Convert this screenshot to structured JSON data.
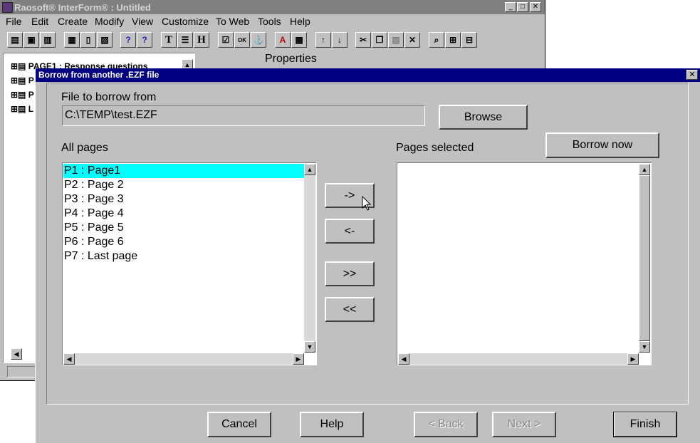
{
  "app": {
    "title": "Raosoft® InterForm® : Untitled",
    "menu": [
      "File",
      "Edit",
      "Create",
      "Modify",
      "View",
      "Customize",
      "To Web",
      "Tools",
      "Help"
    ],
    "tree_items": [
      "PAGE1 : Response questions",
      "P",
      "P",
      "L"
    ],
    "properties_label": "Properties",
    "toolbar_icons": [
      "open-icon",
      "save-icon",
      "print-icon",
      "page-icon",
      "new-page-icon",
      "copy-page-icon",
      "spell-icon",
      "wizard-icon",
      "text-icon",
      "list-icon",
      "heading-icon",
      "checkbox-icon",
      "ok-button-icon",
      "anchor-icon",
      "font-color-icon",
      "form-properties-icon",
      "move-up-icon",
      "move-down-icon",
      "cut-icon",
      "copy-icon",
      "paste-icon",
      "delete-icon",
      "preview-icon",
      "expand-icon",
      "collapse-icon"
    ]
  },
  "dialog": {
    "title": "Borrow from another .EZF file",
    "file_label": "File to borrow from",
    "file_value": "C:\\TEMP\\test.EZF",
    "browse_label": "Browse",
    "borrow_now_label": "Borrow now",
    "all_pages_label": "All pages",
    "pages_selected_label": "Pages selected",
    "all_pages": [
      "P1 : Page1",
      "P2 : Page 2",
      "P3 : Page 3",
      "P4 : Page 4",
      "P5 : Page 5",
      "P6 : Page 6",
      "P7 : Last page"
    ],
    "selected_index": 0,
    "selected_pages": [],
    "add_label": "->",
    "remove_label": "<-",
    "add_all_label": ">>",
    "remove_all_label": "<<",
    "cancel_label": "Cancel",
    "help_label": "Help",
    "back_label": "< Back",
    "next_label": "Next >",
    "finish_label": "Finish",
    "close_glyph": "✕"
  },
  "colors": {
    "selection": "#00ffff",
    "dialog_title_bar": "#000080",
    "face": "#c0c0c0"
  }
}
